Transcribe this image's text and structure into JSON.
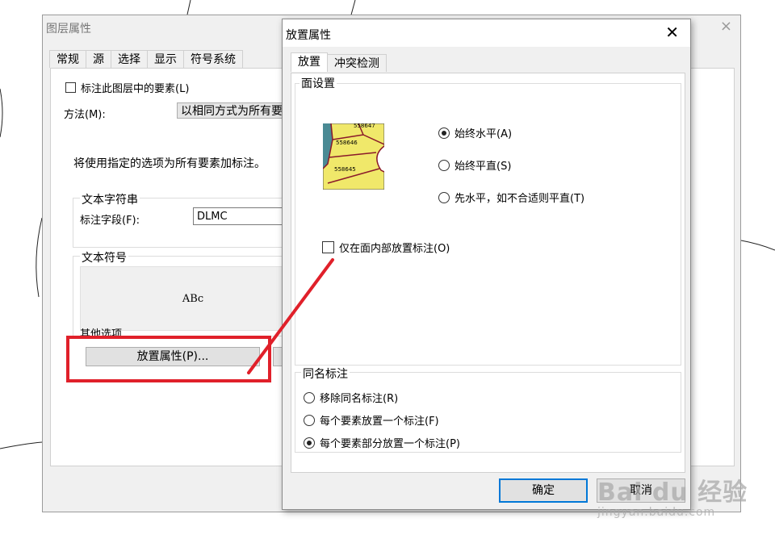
{
  "back_dialog": {
    "title": "图层属性",
    "close_glyph": "×",
    "tabs": [
      "常规",
      "源",
      "选择",
      "显示",
      "符号系统"
    ],
    "label_features_checkbox": "标注此图层中的要素(L)",
    "method_label": "方法(M):",
    "method_value": "以相同方式为所有要",
    "info_text": "将使用指定的选项为所有要素加标注。",
    "text_string_group": "文本字符串",
    "label_field_label": "标注字段(F):",
    "label_field_value": "DLMC",
    "text_symbol_group": "文本符号",
    "symbol_preview": "ABc",
    "other_options_group": "其他选项",
    "placement_button": "放置属性(P)..."
  },
  "front_dialog": {
    "title": "放置属性",
    "close_glyph": "✕",
    "tabs": [
      "放置",
      "冲突检测"
    ],
    "area_group": "面设置",
    "thumbnail_labels": [
      "558647",
      "558646",
      "558645"
    ],
    "placement_options": [
      {
        "label": "始终水平(A)",
        "selected": true
      },
      {
        "label": "始终平直(S)",
        "selected": false
      },
      {
        "label": "先水平，如不合适则平直(T)",
        "selected": false
      }
    ],
    "inside_only_checkbox": "仅在面内部放置标注(O)",
    "duplicate_group": "同名标注",
    "duplicate_options": [
      {
        "label": "移除同名标注(R)",
        "selected": false
      },
      {
        "label": "每个要素放置一个标注(F)",
        "selected": false
      },
      {
        "label": "每个要素部分放置一个标注(P)",
        "selected": true
      }
    ],
    "ok_button": "确定",
    "cancel_button": "取消"
  },
  "watermark": {
    "logo": "Bai du 经验",
    "url": "jingyan.baidu.com"
  },
  "colors": {
    "highlight_red": "#e0202a",
    "focus_blue": "#0078d7",
    "thumb_yellow": "#f0e86a",
    "thumb_teal": "#4a8a94",
    "thumb_border": "#8a1a2a"
  }
}
